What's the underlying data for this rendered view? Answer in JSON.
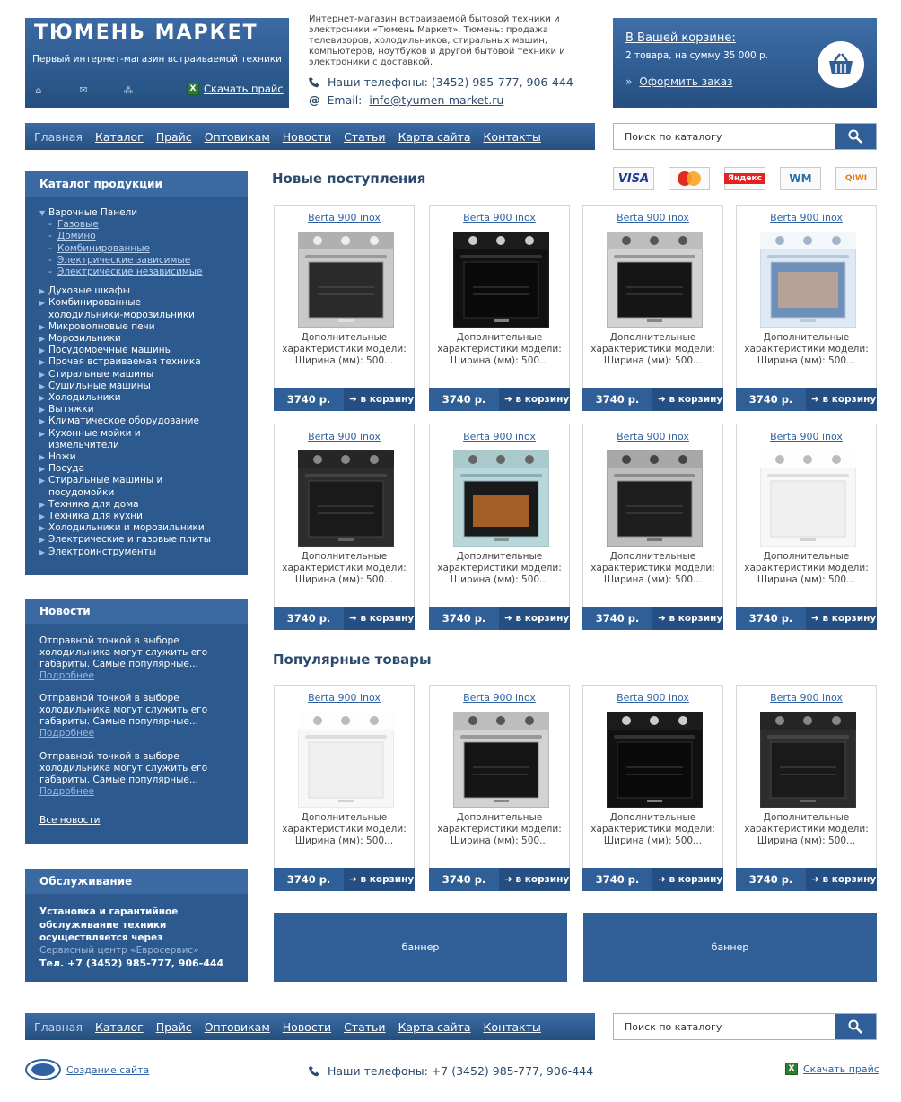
{
  "header": {
    "logo_title": "ТЮМЕНЬ МАРКЕТ",
    "logo_slogan": "Первый интернет-магазин встраиваемой техники",
    "download_price": "Скачать прайс",
    "intro": "Интернет-магазин встраиваемой бытовой техники и электроники «Тюмень Маркет», Тюмень: продажа телевизоров, холодильников, стиральных машин, компьютеров, ноутбуков и другой бытовой техники и электроники с доставкой.",
    "phones_label": "Наши телефоны: (3452) 985-777, 906-444",
    "email_label": "Email:",
    "email": "info@tyumen-market.ru"
  },
  "cart": {
    "title": "В Вашей корзине:",
    "info": "2 товара, на сумму 35 000 р.",
    "order": "Оформить заказ"
  },
  "nav": {
    "items": [
      "Главная",
      "Каталог",
      "Прайс",
      "Оптовикам",
      "Новости",
      "Статьи",
      "Карта сайта",
      "Контакты"
    ]
  },
  "search": {
    "placeholder": "Поиск по каталогу"
  },
  "catalog": {
    "title": "Каталог продукции",
    "open_item": "Варочные Панели",
    "sub_items": [
      "Газовые",
      "Домино",
      "Комбинированные",
      "Электрические зависимые",
      "Электрические независимые"
    ],
    "items": [
      "Духовые шкафы",
      "Комбинированные холодильники-морозильники",
      "Микроволновые печи",
      "Морозильники",
      "Посудомоечные машины",
      "Прочая встраиваемая техника",
      "Стиральные машины",
      "Сушильные машины",
      "Холодильники",
      "Вытяжки",
      "Климатическое оборудование",
      "Кухонные мойки и измельчители",
      "Ножи",
      "Посуда",
      "Стиральные машины и посудомойки",
      "Техника для дома",
      "Техника для кухни",
      "Холодильники и морозильники",
      "Электрические и газовые плиты",
      "Электроинструменты"
    ]
  },
  "news": {
    "title": "Новости",
    "items": [
      {
        "text": "Отправной точкой в выборе холодильника могут служить его габариты. Самые популярные...",
        "more": "Подробнее"
      },
      {
        "text": "Отправной точкой в выборе холодильника могут служить его габариты. Самые популярные...",
        "more": "Подробнее"
      },
      {
        "text": "Отправной точкой в выборе холодильника могут служить его габариты. Самые популярные...",
        "more": "Подробнее"
      }
    ],
    "all": "Все новости"
  },
  "service": {
    "title": "Обслуживание",
    "text": "Установка и гарантийное обслуживание техники осуществляется через",
    "link": "Сервисный центр «Евросервис»",
    "phone": "Тел. +7 (3452) 985-777, 906-444"
  },
  "sections": {
    "new_title": "Новые поступления",
    "popular_title": "Популярные товары"
  },
  "payments": [
    "VISA",
    "MasterCard",
    "Яндекс",
    "WM",
    "QIWI"
  ],
  "product": {
    "name": "Berta 900 inox",
    "desc": "Дополнительные характеристики модели: Ширина (мм): 500...",
    "price": "3740 р.",
    "buy": "в корзину"
  },
  "oven_styles": [
    "silver",
    "black",
    "steel-black",
    "white-blue",
    "dark",
    "aqua",
    "steel",
    "white",
    "white",
    "steel-black",
    "black",
    "dark"
  ],
  "banners": [
    "баннер",
    "баннер"
  ],
  "footer": {
    "made_by": "Создание сайта",
    "phones": "Наши телефоны: +7 (3452) 985-777, 906-444",
    "download_price": "Скачать прайс"
  },
  "colors": {
    "brand": "#2d5a8e",
    "accent": "#2f62a3"
  }
}
